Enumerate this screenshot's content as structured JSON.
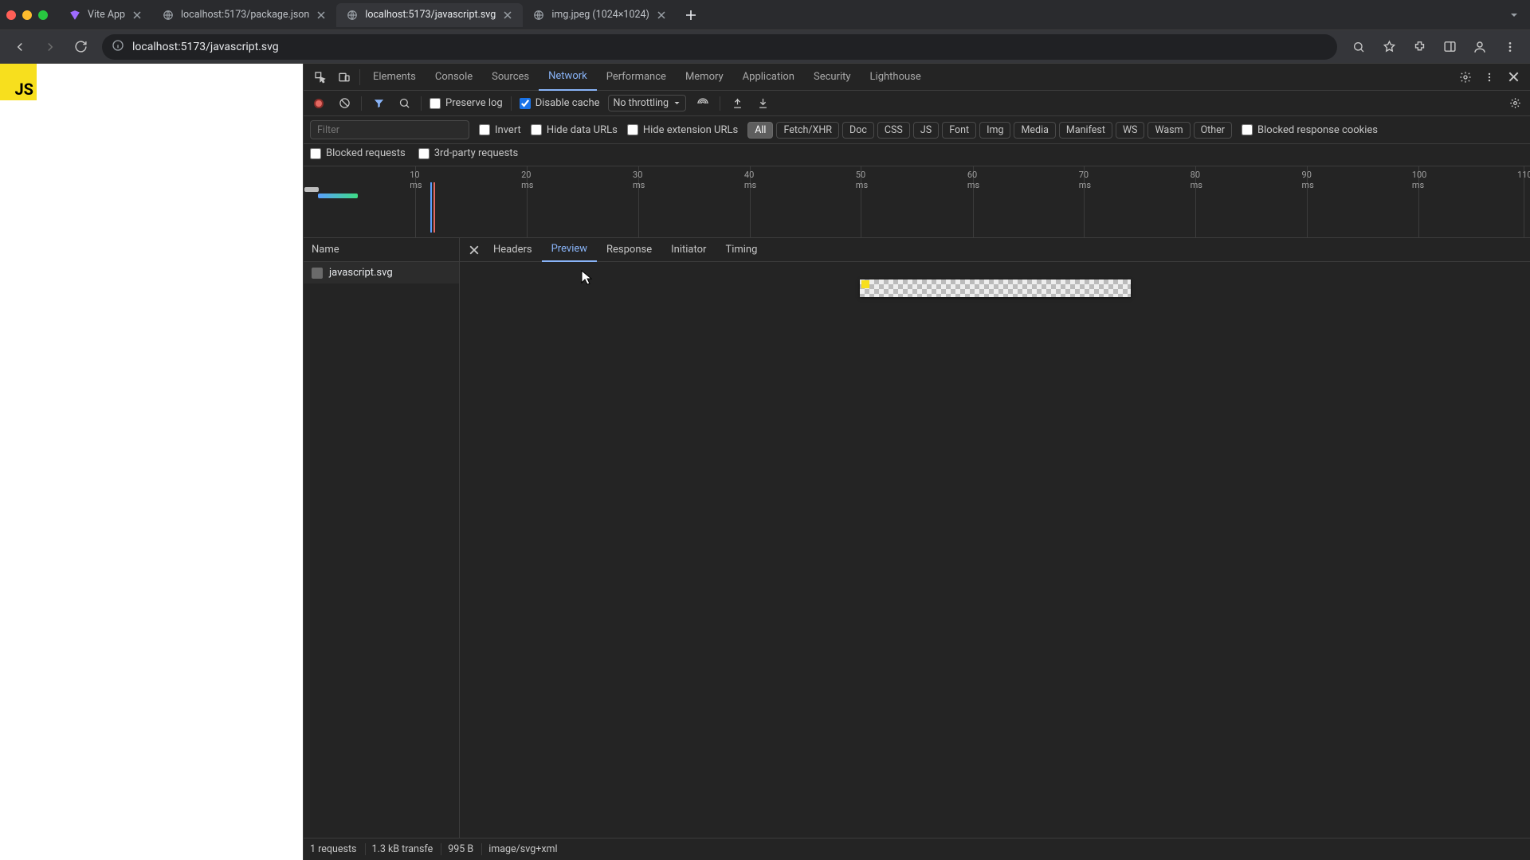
{
  "tabs": [
    {
      "title": "Vite App"
    },
    {
      "title": "localhost:5173/package.json"
    },
    {
      "title": "localhost:5173/javascript.svg"
    },
    {
      "title": "img.jpeg (1024×1024)"
    }
  ],
  "active_tab_index": 2,
  "url": "localhost:5173/javascript.svg",
  "page": {
    "js_badge": "JS"
  },
  "devtools": {
    "panels": [
      "Elements",
      "Console",
      "Sources",
      "Network",
      "Performance",
      "Memory",
      "Application",
      "Security",
      "Lighthouse"
    ],
    "active_panel": "Network"
  },
  "network_toolbar": {
    "preserve_log": {
      "label": "Preserve log",
      "checked": false
    },
    "disable_cache": {
      "label": "Disable cache",
      "checked": true
    },
    "throttling": "No throttling"
  },
  "filters": {
    "placeholder": "Filter",
    "invert": {
      "label": "Invert",
      "checked": false
    },
    "hide_data_urls": {
      "label": "Hide data URLs",
      "checked": false
    },
    "hide_extension_urls": {
      "label": "Hide extension URLs",
      "checked": false
    },
    "type_pills": [
      "All",
      "Fetch/XHR",
      "Doc",
      "CSS",
      "JS",
      "Font",
      "Img",
      "Media",
      "Manifest",
      "WS",
      "Wasm",
      "Other"
    ],
    "active_pill": "All",
    "blocked_response_cookies": {
      "label": "Blocked response cookies",
      "checked": false
    },
    "blocked_requests": {
      "label": "Blocked requests",
      "checked": false
    },
    "third_party": {
      "label": "3rd-party requests",
      "checked": false
    }
  },
  "timeline": {
    "ticks": [
      "10 ms",
      "20 ms",
      "30 ms",
      "40 ms",
      "50 ms",
      "60 ms",
      "70 ms",
      "80 ms",
      "90 ms",
      "100 ms",
      "110"
    ]
  },
  "request_list": {
    "header": "Name",
    "items": [
      {
        "name": "javascript.svg"
      }
    ],
    "selected_index": 0
  },
  "detail_tabs": {
    "items": [
      "Headers",
      "Preview",
      "Response",
      "Initiator",
      "Timing"
    ],
    "active": "Preview"
  },
  "status": {
    "requests": "1 requests",
    "transferred": "1.3 kB transfe",
    "resources": "995 B",
    "mime": "image/svg+xml"
  }
}
